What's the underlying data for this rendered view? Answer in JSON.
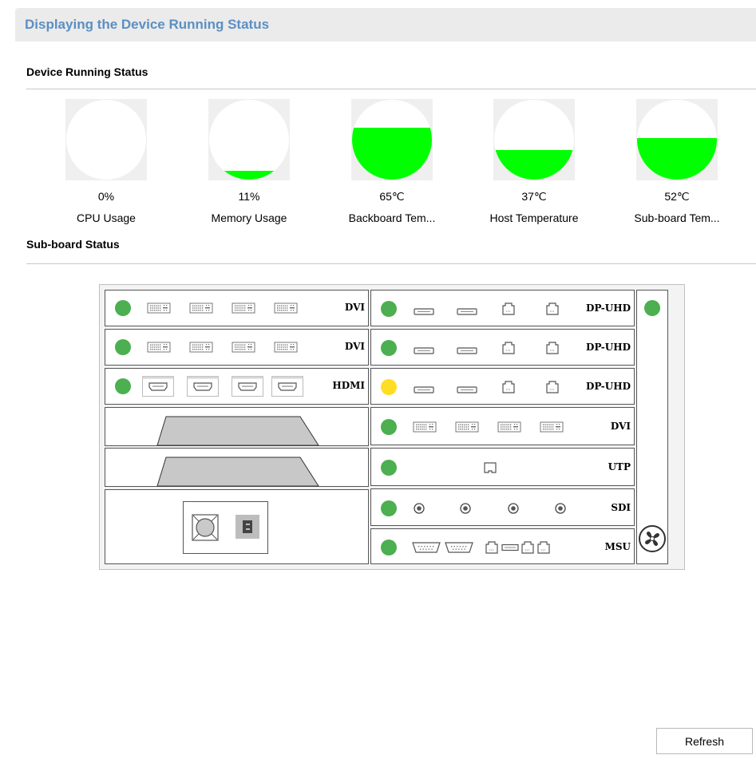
{
  "page": {
    "title": "Displaying the Device Running Status",
    "running_section": "Device Running Status",
    "subboard_section": "Sub-board Status",
    "refresh_label": "Refresh"
  },
  "gauges": [
    {
      "value": "0%",
      "label": "CPU Usage",
      "level": 0
    },
    {
      "value": "11%",
      "label": "Memory Usage",
      "level": 0.11
    },
    {
      "value": "65℃",
      "label": "Backboard Tem...",
      "level": 0.65
    },
    {
      "value": "37℃",
      "label": "Host Temperature",
      "level": 0.37
    },
    {
      "value": "52℃",
      "label": "Sub-board Tem...",
      "level": 0.52
    }
  ],
  "colors": {
    "fill": "#00ff00",
    "led_ok": "#4caf50",
    "led_warn": "#ffdd22",
    "title": "#5b8fc3"
  },
  "left_slots": [
    {
      "label": "DVI",
      "status": "green",
      "port_type": "dvi"
    },
    {
      "label": "DVI",
      "status": "green",
      "port_type": "dvi"
    },
    {
      "label": "HDMI",
      "status": "green",
      "port_type": "hdmi"
    }
  ],
  "right_slots": [
    {
      "label": "DP-UHD",
      "status": "green",
      "port_type": "dp"
    },
    {
      "label": "DP-UHD",
      "status": "green",
      "port_type": "dp"
    },
    {
      "label": "DP-UHD",
      "status": "yellow",
      "port_type": "dp"
    },
    {
      "label": "DVI",
      "status": "green",
      "port_type": "dvi"
    },
    {
      "label": "UTP",
      "status": "green",
      "port_type": "utp"
    },
    {
      "label": "SDI",
      "status": "green",
      "port_type": "sdi"
    },
    {
      "label": "MSU",
      "status": "green",
      "port_type": "msu"
    }
  ],
  "fan_column": {
    "status": "green",
    "icon": "fan-icon"
  },
  "power_module": {
    "icons": [
      "fan-grille-icon",
      "power-socket-icon"
    ]
  }
}
